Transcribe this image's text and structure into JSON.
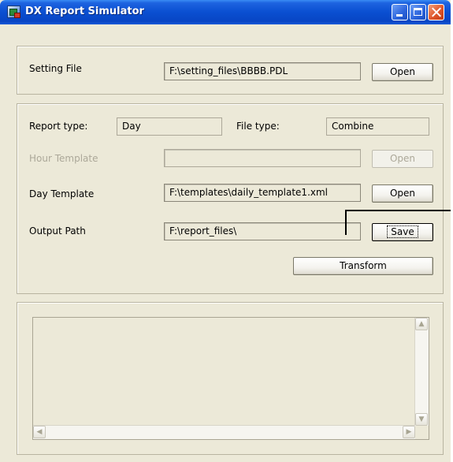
{
  "window": {
    "title": "DX Report Simulator",
    "icon": "app-spreadsheet-icon"
  },
  "setting": {
    "label": "Setting File",
    "path": "F:\\setting_files\\BBBB.PDL",
    "open_label": "Open"
  },
  "report": {
    "type_label": "Report type:",
    "type_value": "Day",
    "file_type_label": "File type:",
    "file_type_value": "Combine"
  },
  "hour_template": {
    "label": "Hour Template",
    "path": "",
    "open_label": "Open"
  },
  "day_template": {
    "label": "Day Template",
    "path": "F:\\templates\\daily_template1.xml",
    "open_label": "Open"
  },
  "output": {
    "label": "Output Path",
    "path": "F:\\report_files\\",
    "save_label": "Save"
  },
  "transform_label": "Transform",
  "colors": {
    "titlebar": "#0a4fd1",
    "face": "#ece9d8",
    "disabled_text": "#aca899"
  }
}
